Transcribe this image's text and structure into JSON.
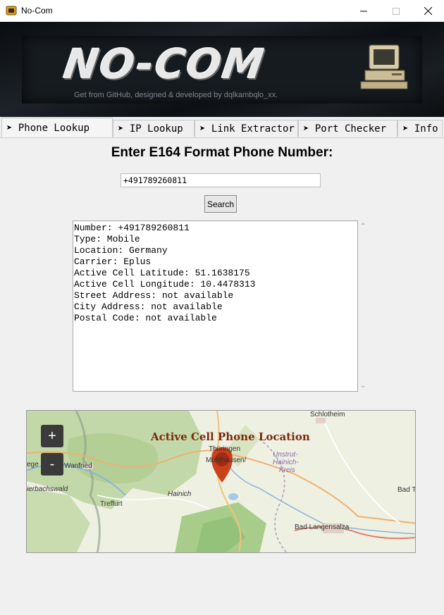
{
  "window": {
    "title": "No-Com"
  },
  "banner": {
    "title": "NO-COM",
    "subtitle": "Get from GitHub, designed & developed by dqlkambqlo_xx."
  },
  "tabs": [
    {
      "label": "➤ Phone Lookup"
    },
    {
      "label": "➤ IP Lookup"
    },
    {
      "label": "➤ Link Extractor"
    },
    {
      "label": "➤ Port Checker"
    },
    {
      "label": "➤ Info"
    }
  ],
  "phone": {
    "heading": "Enter E164 Format Phone Number:",
    "input_value": "+491789260811",
    "search_label": "Search",
    "results": [
      "Number: +491789260811",
      "Type: Mobile",
      "Location: Germany",
      "Carrier: Eplus",
      "Active Cell Latitude: 51.1638175",
      "Active Cell Longitude: 10.4478313",
      "Street Address: not available",
      "City Address: not available",
      "Postal Code: not available"
    ]
  },
  "map": {
    "title": "Active Cell Phone Location",
    "zoom_in": "+",
    "zoom_out": "-",
    "places": {
      "schlotheim": "Schlotheim",
      "muhlhausen": "Mühlhausen/",
      "thuringen": "Thüringen",
      "unstrut1": "Unstrut-",
      "unstrut2": "Hainich-",
      "unstrut3": "Kreis",
      "ege": "ege",
      "wanfried": "Wanfried",
      "ierbachswald": "ierbachswald",
      "treffurt": "Treffurt",
      "hainich": "Hainich",
      "badt": "Bad T",
      "badlangensalza": "Bad Langensalza"
    },
    "colors": {
      "marker": "#c8421c",
      "title": "#7a2a10"
    }
  }
}
